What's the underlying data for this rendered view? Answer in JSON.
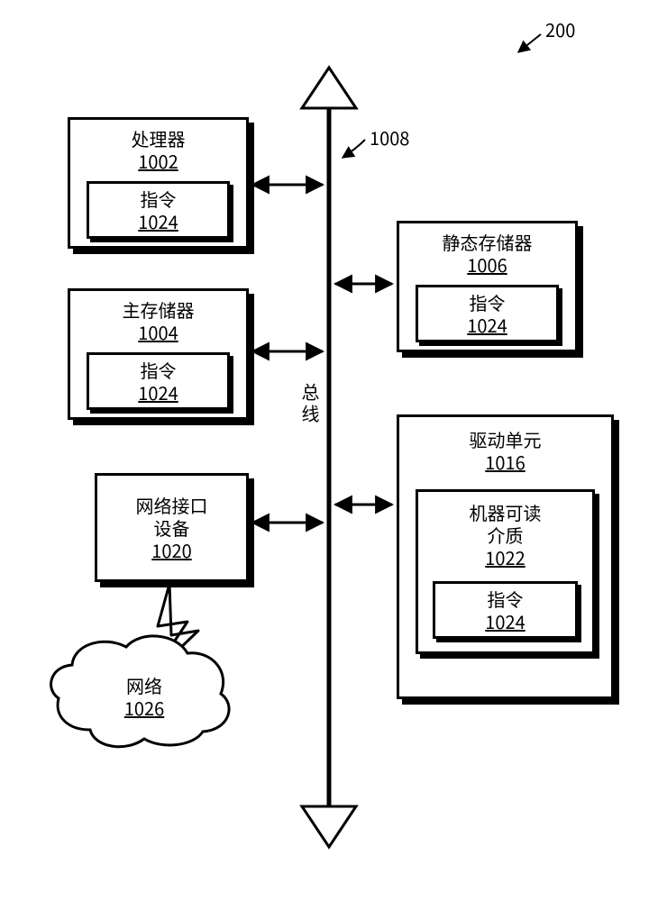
{
  "figure_ref": "200",
  "bus": {
    "label_vertical": "总线",
    "ref": "1008"
  },
  "blocks": {
    "processor": {
      "label": "处理器",
      "num": "1002",
      "instr_label": "指令",
      "instr_num": "1024"
    },
    "main_memory": {
      "label": "主存储器",
      "num": "1004",
      "instr_label": "指令",
      "instr_num": "1024"
    },
    "static_memory": {
      "label": "静态存储器",
      "num": "1006",
      "instr_label": "指令",
      "instr_num": "1024"
    },
    "netif": {
      "label1": "网络接口",
      "label2": "设备",
      "num": "1020"
    },
    "drive": {
      "label": "驱动单元",
      "num": "1016",
      "medium": {
        "label1": "机器可读",
        "label2": "介质",
        "num": "1022",
        "instr_label": "指令",
        "instr_num": "1024"
      }
    },
    "network": {
      "label": "网络",
      "num": "1026"
    }
  }
}
